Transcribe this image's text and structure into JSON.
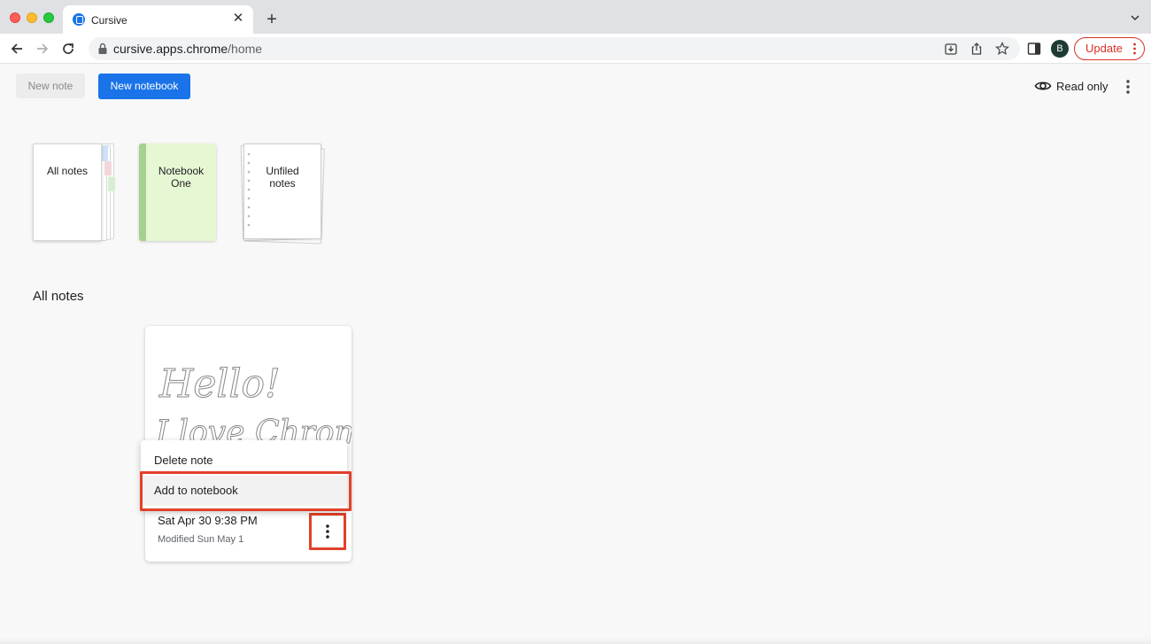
{
  "browser": {
    "tab_title": "Cursive",
    "url_host": "cursive.apps.chrome",
    "url_path": "/home",
    "profile_initial": "B",
    "update_label": "Update"
  },
  "app": {
    "new_note_label": "New note",
    "new_notebook_label": "New notebook",
    "read_only_label": "Read only"
  },
  "notebooks": [
    {
      "label": "All notes"
    },
    {
      "label": "Notebook One"
    },
    {
      "label": "Unfiled notes"
    }
  ],
  "section_title": "All notes",
  "note": {
    "handwriting_line1": "Hello!",
    "handwriting_line2": "I love Chrome",
    "date": "Sat Apr 30 9:38 PM",
    "modified": "Modified Sun May 1"
  },
  "context_menu": {
    "items": [
      {
        "label": "Delete note"
      },
      {
        "label": "Add to notebook"
      }
    ]
  },
  "colors": {
    "accent": "#1a73e8",
    "highlight": "#e2402a",
    "notebook_green": "#e6f7d3"
  }
}
